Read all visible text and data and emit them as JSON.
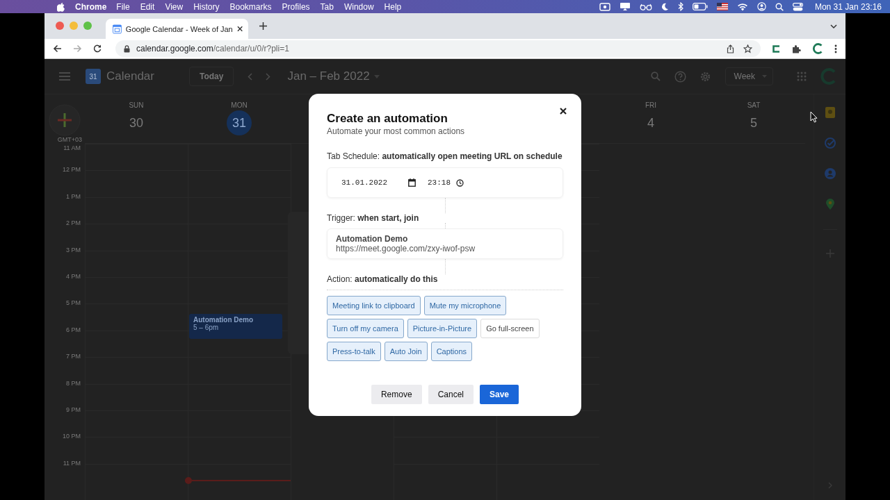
{
  "menubar": {
    "app": "Chrome",
    "menus": [
      "File",
      "Edit",
      "View",
      "History",
      "Bookmarks",
      "Profiles",
      "Tab",
      "Window",
      "Help"
    ],
    "clock": "Mon 31 Jan  23:16"
  },
  "browser": {
    "tab": {
      "title": "Google Calendar - Week of Jan",
      "selected": true
    },
    "url": {
      "host": "calendar.google.com",
      "path": "/calendar/u/0/r?pli=1"
    }
  },
  "calendar": {
    "logo_day": "31",
    "app_name": "Calendar",
    "today_button": "Today",
    "range": "Jan – Feb 2022",
    "view": "Week",
    "days": [
      {
        "weekday": "SUN",
        "date": "30",
        "selected": false,
        "current_time": false
      },
      {
        "weekday": "MON",
        "date": "31",
        "selected": true,
        "events": [
          {
            "title": "Automation Demo",
            "time": "5 – 6pm"
          }
        ],
        "current_time": true
      },
      {
        "weekday": "FRI",
        "date": "4",
        "selected": false,
        "current_time": false
      },
      {
        "weekday": "SAT",
        "date": "5",
        "selected": false,
        "current_time": false
      }
    ],
    "timezone": "GMT+03",
    "hours": [
      "11 AM",
      "12 PM",
      "1 PM",
      "2 PM",
      "3 PM",
      "4 PM",
      "5 PM",
      "6 PM",
      "7 PM",
      "8 PM",
      "9 PM",
      "10 PM",
      "11 PM"
    ]
  },
  "dialog": {
    "title": "Create an automation",
    "subtitle": "Automate your most common actions",
    "schedule": {
      "label": "Tab Schedule: **automatically open meeting URL on schedule**",
      "date": "31.01.2022",
      "time": "23:18"
    },
    "trigger": {
      "label": "Trigger: **when start, join**",
      "meeting_title": "Automation Demo",
      "meeting_url": "https://meet.google.com/zxy-iwof-psw"
    },
    "action": {
      "label": "Action: **automatically do this**"
    },
    "actions": [
      [
        {
          "label": "Meeting link to clipboard",
          "selected": true
        },
        {
          "label": "Mute my microphone",
          "selected": true
        }
      ],
      [
        {
          "label": "Turn off my camera",
          "selected": true
        },
        {
          "label": "Picture-in-Picture",
          "selected": true
        },
        {
          "label": "Go full-screen",
          "selected": false
        }
      ],
      [
        {
          "label": "Press-to-talk",
          "selected": true
        },
        {
          "label": "Auto Join",
          "selected": true
        },
        {
          "label": "Captions",
          "selected": true
        }
      ]
    ],
    "buttons": [
      {
        "label": "Remove",
        "kind": "secondary"
      },
      {
        "label": "Cancel",
        "kind": "secondary"
      },
      {
        "label": "Save",
        "kind": "primary"
      }
    ]
  }
}
